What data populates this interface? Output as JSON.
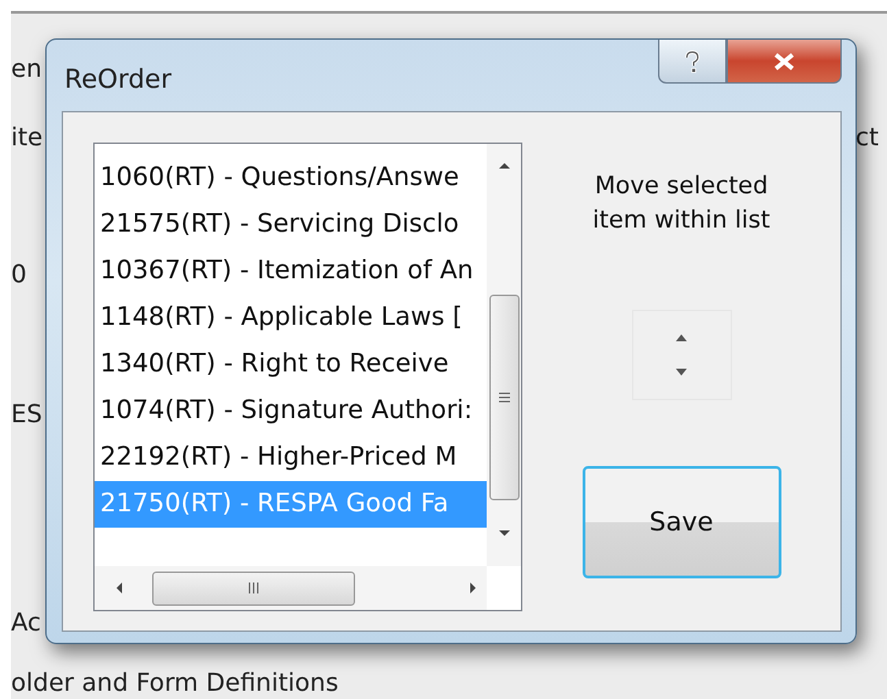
{
  "background_fragments": [
    "en",
    "ite",
    "0",
    "ES",
    "Ac",
    "older and Form Definitions",
    "ct"
  ],
  "window": {
    "title": "ReOrder"
  },
  "list": {
    "items": [
      {
        "label": "1060(RT) - Questions/Answe",
        "selected": false
      },
      {
        "label": "21575(RT) - Servicing Disclo",
        "selected": false
      },
      {
        "label": "10367(RT) - Itemization of An",
        "selected": false
      },
      {
        "label": "1148(RT) - Applicable Laws [",
        "selected": false
      },
      {
        "label": "1340(RT) - Right to Receive",
        "selected": false
      },
      {
        "label": "1074(RT) - Signature Authori:",
        "selected": false
      },
      {
        "label": "22192(RT) - Higher-Priced M",
        "selected": false
      },
      {
        "label": "21750(RT) - RESPA Good Fa",
        "selected": true
      }
    ]
  },
  "hint": "Move selected item within list",
  "buttons": [
    "Save"
  ]
}
